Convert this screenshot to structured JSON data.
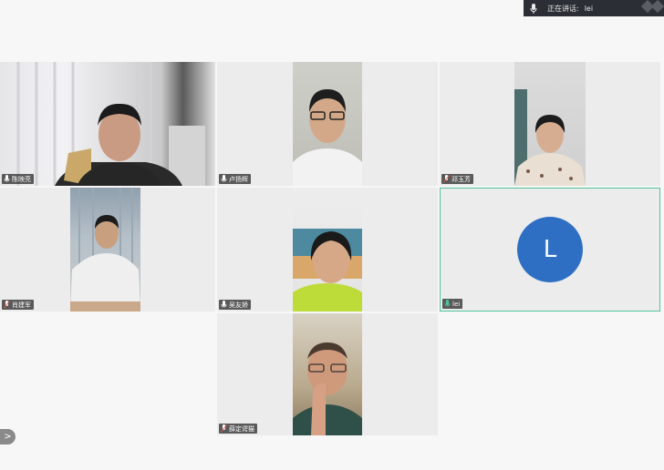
{
  "speaking_indicator": {
    "label": "正在讲话:",
    "speaker": "lei"
  },
  "participants": [
    {
      "name": "陈映亮"
    },
    {
      "name": "卢扬辉"
    },
    {
      "name": "邓玉芳"
    },
    {
      "name": "肖建军"
    },
    {
      "name": "吴友娇"
    },
    {
      "name": "lei",
      "avatar_letter": "L"
    },
    {
      "name": "薛定谔猫"
    }
  ],
  "colors": {
    "active_border": "#4fc59a",
    "avatar_bg": "#2e6fc4",
    "tile_bg": "#ececec"
  },
  "icons": {
    "mic": "microphone-icon",
    "collapse": "chevron-right-icon"
  },
  "collapse_glyph": ">"
}
